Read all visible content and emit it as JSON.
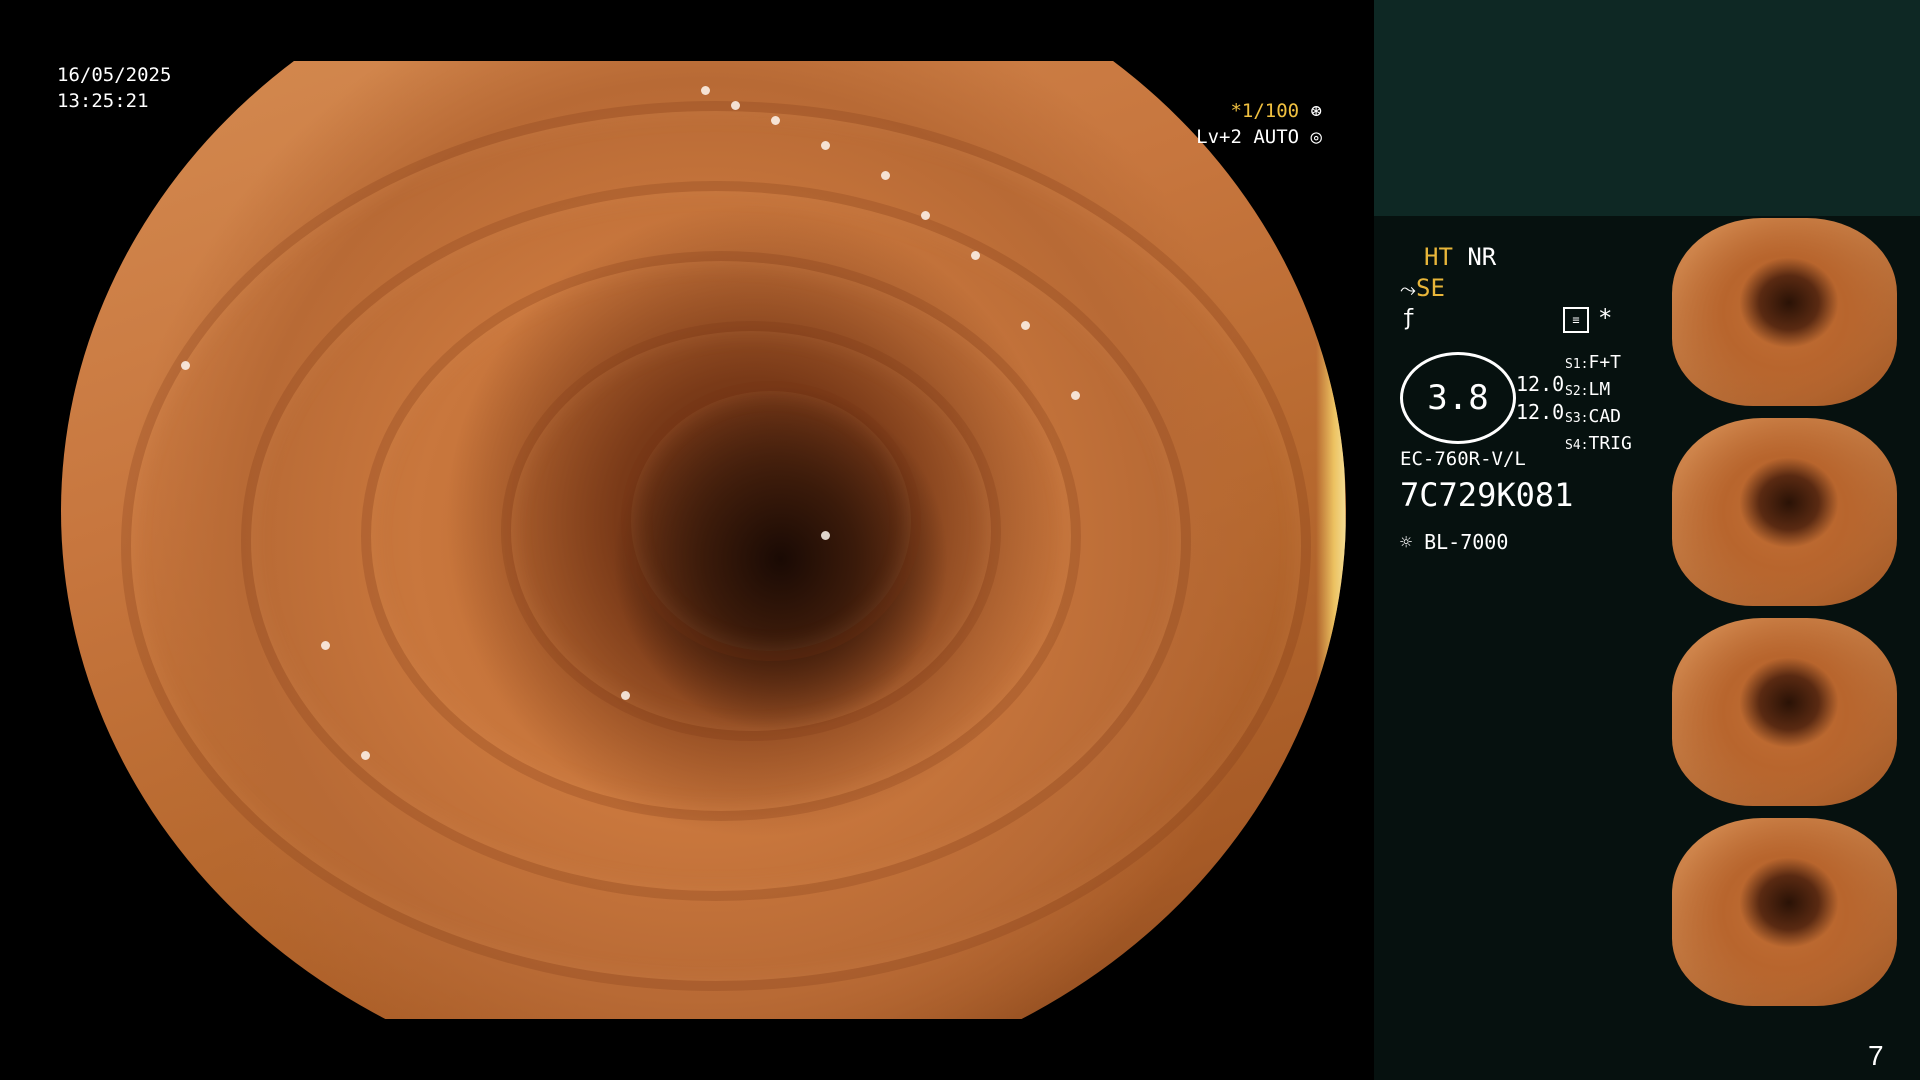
{
  "datetime": {
    "date": "16/05/2025",
    "time": "13:25:21"
  },
  "exposure": {
    "shutter": "*1/100",
    "shutter_icon": "aperture-icon",
    "level": "Lv+2 AUTO",
    "level_icon": "iris-icon"
  },
  "panel": {
    "modes": {
      "ht": "HT",
      "nr": "NR",
      "se": "SE",
      "se_icon": "tilde-icon",
      "fn_icon": "function-icon",
      "menu_icon": "menu-icon",
      "star": "*"
    },
    "gauge": {
      "value": "3.8",
      "row1": "12.0",
      "row2": "12.0"
    },
    "switches": [
      {
        "key": "S1:",
        "value": "F+T"
      },
      {
        "key": "S2:",
        "value": "LM"
      },
      {
        "key": "S3:",
        "value": "CAD"
      },
      {
        "key": "S4:",
        "value": "TRIG"
      }
    ],
    "scope": {
      "model": "EC-760R-V/L",
      "serial": "7C729K081"
    },
    "light": {
      "icon": "light-source-icon",
      "label": "BL-7000"
    }
  },
  "page_number": "7"
}
